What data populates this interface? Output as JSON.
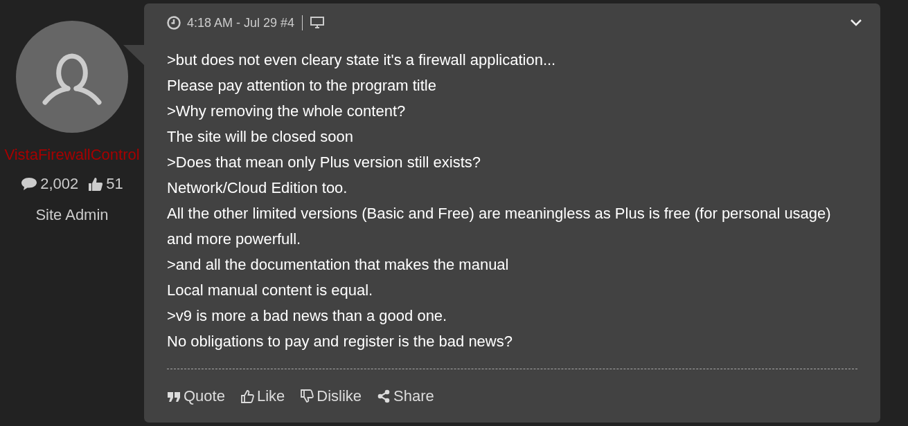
{
  "author": {
    "name": "VistaFirewallControl",
    "messages": "2,002",
    "likes": "51",
    "role": "Site Admin"
  },
  "post": {
    "time": "4:18 AM - Jul 29",
    "number": "#4",
    "lines": [
      ">but does not even cleary state it's a firewall application...",
      "Please pay attention to the program title",
      ">Why removing the whole content?",
      "The site will be closed soon",
      ">Does that mean only Plus version still exists?",
      "Network/Cloud Edition too.",
      "All the other limited versions (Basic and Free) are meaningless as Plus is free (for personal usage) and more powerfull.",
      ">and all the documentation that makes the manual",
      "Local manual content is equal.",
      ">v9 is more a bad news than a good one.",
      "No obligations to pay and register is the bad news?"
    ],
    "actions": [
      {
        "kind": "quote",
        "label": "Quote"
      },
      {
        "kind": "like",
        "label": "Like"
      },
      {
        "kind": "dislike",
        "label": "Dislike"
      },
      {
        "kind": "share",
        "label": "Share"
      }
    ]
  }
}
